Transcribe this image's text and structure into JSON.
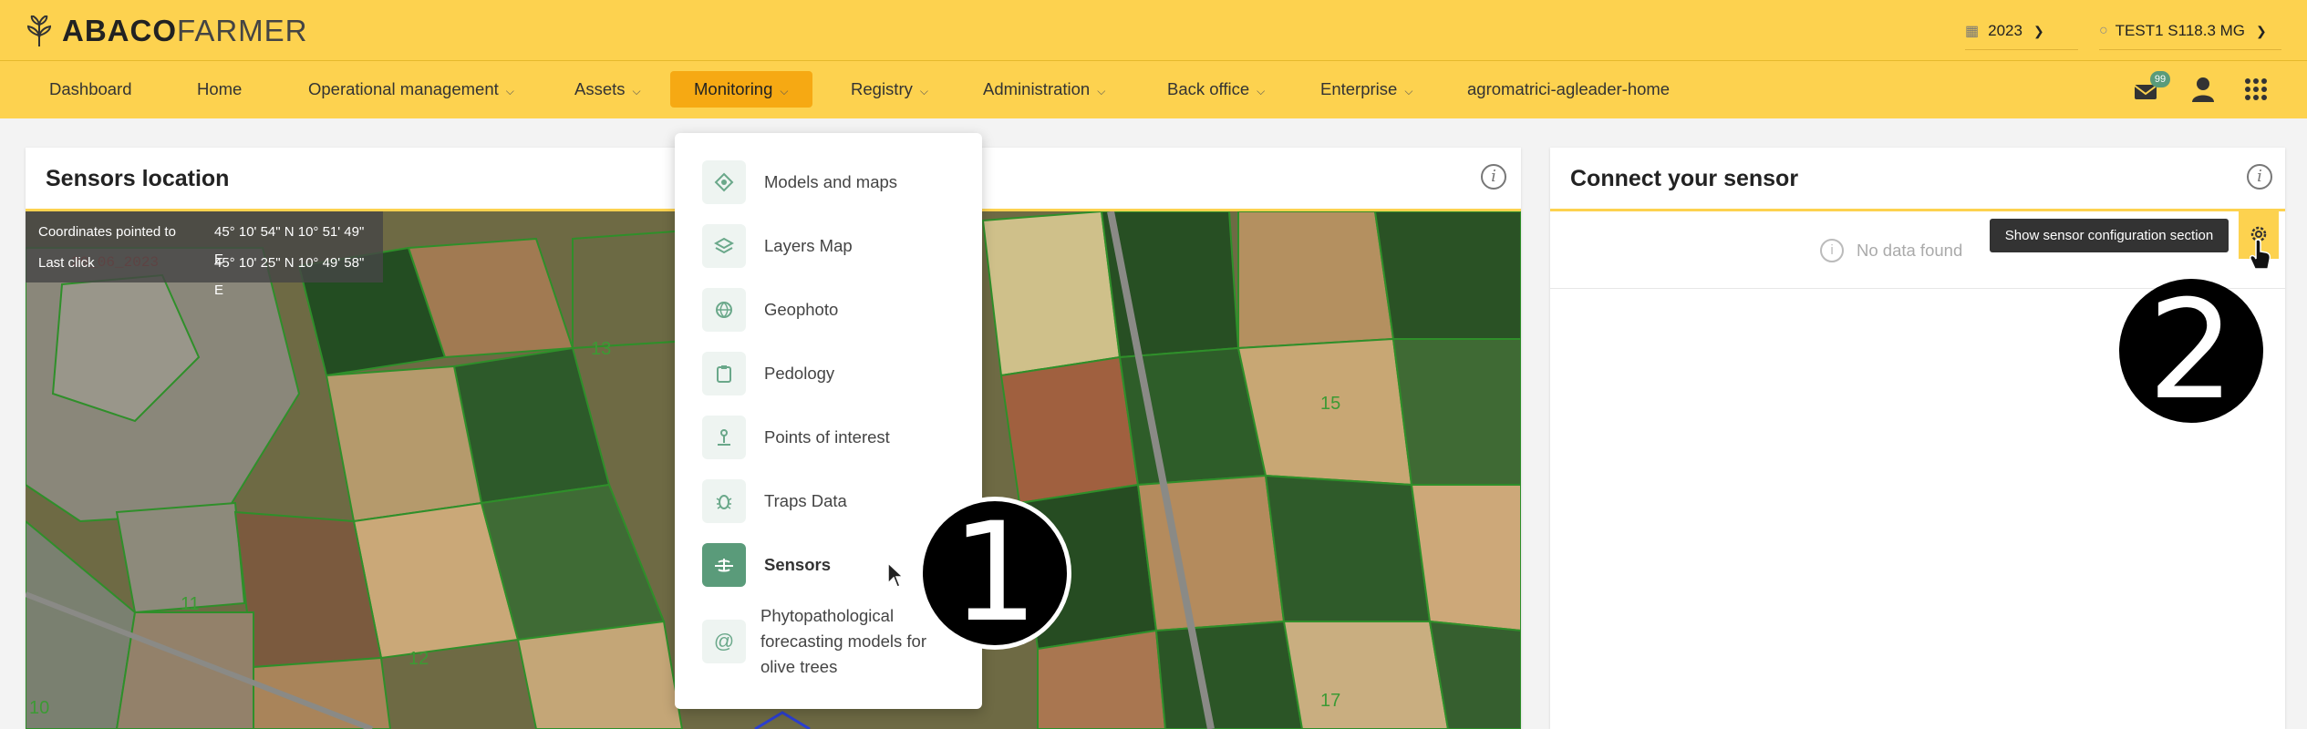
{
  "brand": {
    "bold": "ABACO",
    "light": "FARMER"
  },
  "header": {
    "year": "2023",
    "user": "TEST1 S118.3 MG"
  },
  "nav": {
    "items": [
      {
        "label": "Dashboard"
      },
      {
        "label": "Home"
      },
      {
        "label": "Operational management"
      },
      {
        "label": "Assets"
      },
      {
        "label": "Monitoring"
      },
      {
        "label": "Registry"
      },
      {
        "label": "Administration"
      },
      {
        "label": "Back office"
      },
      {
        "label": "Enterprise"
      },
      {
        "label": "agromatrici-agleader-home"
      }
    ],
    "active": "Monitoring",
    "notification_count": "99"
  },
  "sensors_panel": {
    "title": "Sensors location",
    "coords": {
      "pointed_label": "Coordinates pointed to",
      "pointed_value": "45° 10' 54\" N 10° 51' 49\" E",
      "click_label": "Last click",
      "click_value": "45° 10' 25\" N 10° 49' 58\" E"
    },
    "map_labels": [
      "13",
      "11",
      "15",
      "17",
      "10",
      "12"
    ]
  },
  "monitoring_menu": {
    "items": [
      {
        "label": "Models and maps",
        "icon": "target-icon"
      },
      {
        "label": "Layers Map",
        "icon": "layers-icon"
      },
      {
        "label": "Geophoto",
        "icon": "globe-icon"
      },
      {
        "label": "Pedology",
        "icon": "clipboard-icon"
      },
      {
        "label": "Points of interest",
        "icon": "pin-icon"
      },
      {
        "label": "Traps Data",
        "icon": "bug-icon"
      },
      {
        "label": "Sensors",
        "icon": "sensor-icon",
        "active": true
      },
      {
        "label": "Phytopathological forecasting models for olive trees",
        "icon": "at-icon"
      }
    ]
  },
  "connect_panel": {
    "title": "Connect your sensor",
    "no_data": "No data found",
    "tooltip": "Show sensor configuration section"
  },
  "badges": {
    "one": "1",
    "two": "2"
  },
  "colors": {
    "header": "#fdd24f",
    "active_nav": "#f6a913",
    "sensor_active": "#5a9b7a"
  }
}
